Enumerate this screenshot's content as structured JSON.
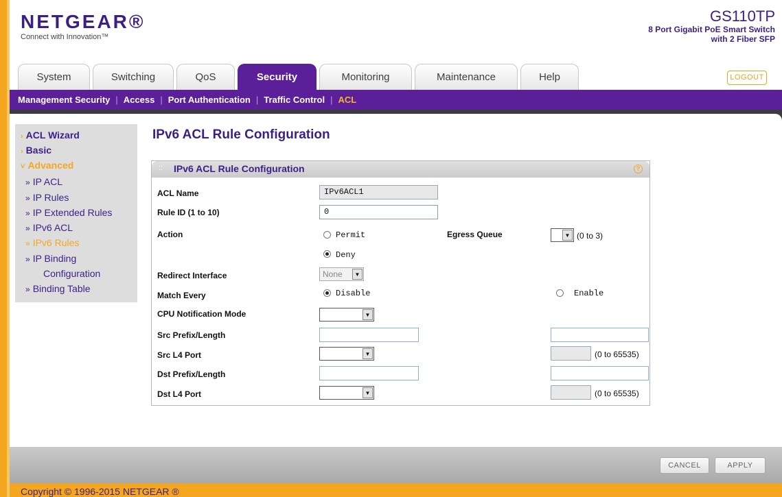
{
  "brand": {
    "logo": "NETGEAR®",
    "tagline": "Connect with Innovation™",
    "model": "GS110TP",
    "model_line1": "8 Port Gigabit PoE Smart Switch",
    "model_line2": "with 2 Fiber SFP"
  },
  "tabs": [
    "System",
    "Switching",
    "QoS",
    "Security",
    "Monitoring",
    "Maintenance",
    "Help"
  ],
  "active_tab": "Security",
  "logout_label": "LOGOUT",
  "subnav": [
    "Management Security",
    "Access",
    "Port Authentication",
    "Traffic Control",
    "ACL"
  ],
  "active_subnav": "ACL",
  "sidemenu": {
    "acl_wizard": "ACL Wizard",
    "basic": "Basic",
    "advanced": "Advanced",
    "ip_acl": "IP ACL",
    "ip_rules": "IP Rules",
    "ip_extended_rules": "IP Extended Rules",
    "ipv6_acl": "IPv6 ACL",
    "ipv6_rules": "IPv6 Rules",
    "ip_binding_1": "IP Binding",
    "ip_binding_2": "Configuration",
    "binding_table": "Binding Table"
  },
  "page_title": "IPv6 ACL Rule Configuration",
  "panel_title": "IPv6 ACL Rule Configuration",
  "form": {
    "acl_name_label": "ACL Name",
    "acl_name_value": "IPv6ACL1",
    "rule_id_label": "Rule ID (1 to 10)",
    "rule_id_value": "0",
    "action_label": "Action",
    "permit": "Permit",
    "deny": "Deny",
    "action_selected": "Deny",
    "egress_queue_label": "Egress Queue",
    "egress_queue_range": "(0 to 3)",
    "redirect_interface_label": "Redirect Interface",
    "redirect_interface_value": "None",
    "match_every_label": "Match Every",
    "disable": "Disable",
    "enable": "Enable",
    "match_every_selected": "Disable",
    "cpu_notification_label": "CPU Notification Mode",
    "src_prefix_label": "Src Prefix/Length",
    "src_l4_port_label": "Src L4 Port",
    "src_l4_port_range": "(0 to 65535)",
    "dst_prefix_label": "Dst Prefix/Length",
    "dst_l4_port_label": "Dst L4 Port",
    "dst_l4_port_range": "(0 to 65535)"
  },
  "buttons": {
    "cancel": "CANCEL",
    "apply": "APPLY"
  },
  "footer": "Copyright © 1996-2015 NETGEAR ®",
  "colors": {
    "brand_purple": "#5b1f99",
    "accent_orange": "#f5a623"
  }
}
